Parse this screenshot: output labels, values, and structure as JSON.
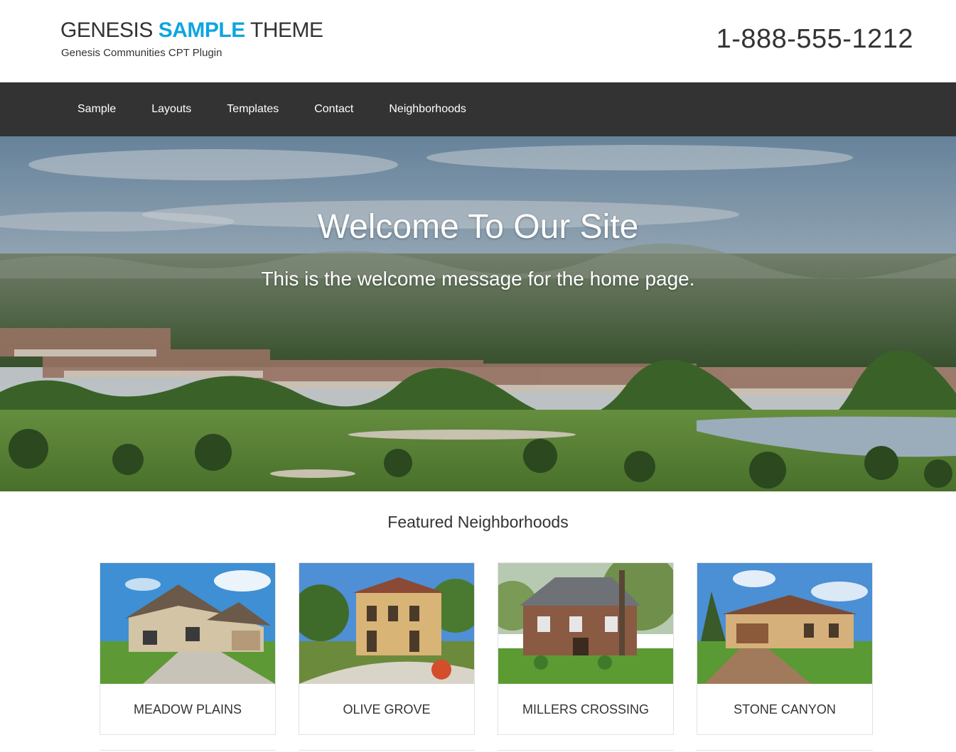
{
  "header": {
    "title_part1": "GENESIS",
    "title_accent": "SAMPLE",
    "title_part2": "THEME",
    "description": "Genesis Communities CPT Plugin",
    "phone": "1-888-555-1212",
    "accent_color": "#0ea5e0"
  },
  "nav": {
    "background": "#333333",
    "items": [
      {
        "label": "Sample"
      },
      {
        "label": "Layouts"
      },
      {
        "label": "Templates"
      },
      {
        "label": "Contact"
      },
      {
        "label": "Neighborhoods"
      }
    ]
  },
  "hero": {
    "title": "Welcome To Our Site",
    "subtitle": "This is the welcome message for the home page."
  },
  "featured": {
    "title": "Featured Neighborhoods",
    "items": [
      {
        "name": "MEADOW PLAINS"
      },
      {
        "name": "OLIVE GROVE"
      },
      {
        "name": "MILLERS CROSSING"
      },
      {
        "name": "STONE CANYON"
      }
    ]
  }
}
